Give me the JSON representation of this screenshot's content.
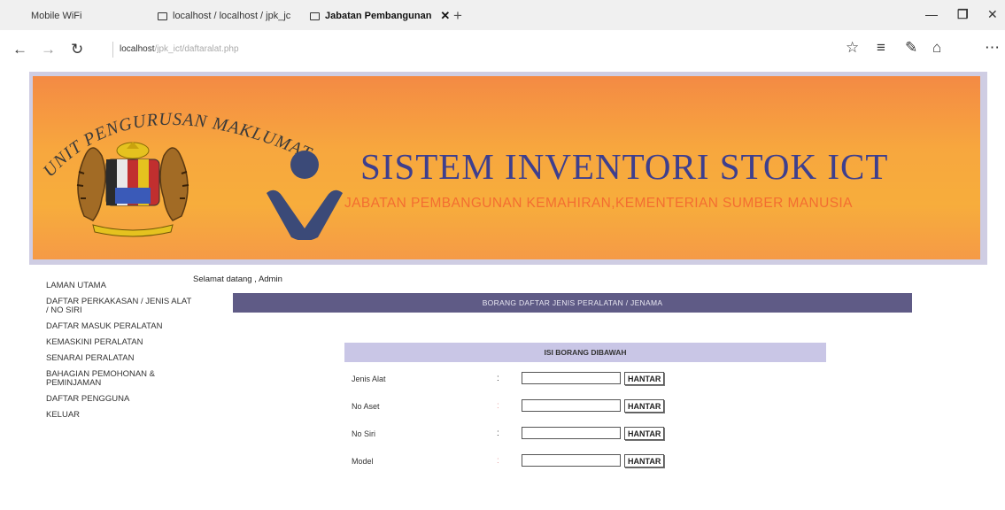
{
  "browser": {
    "tabs": [
      {
        "label": "Mobile WiFi"
      },
      {
        "label": "localhost / localhost / jpk_jc"
      },
      {
        "label": "Jabatan Pembangunan"
      }
    ],
    "address": {
      "host": "localhost",
      "path": "/jpk_ict/daftaralat.php"
    }
  },
  "banner": {
    "arc_text": "UNIT PENGURUSAN MAKLUMAT",
    "title": "SISTEM INVENTORI STOK ICT",
    "subtitle": "JABATAN PEMBANGUNAN KEMAHIRAN,KEMENTERIAN SUMBER MANUSIA"
  },
  "sidebar": {
    "items": [
      {
        "label": "LAMAN UTAMA"
      },
      {
        "label": "DAFTAR PERKAKASAN / JENIS ALAT / NO SIRI"
      },
      {
        "label": "DAFTAR MASUK PERALATAN"
      },
      {
        "label": "KEMASKINI PERALATAN"
      },
      {
        "label": "SENARAI PERALATAN"
      },
      {
        "label": "BAHAGIAN PEMOHONAN & PEMINJAMAN"
      },
      {
        "label": "DAFTAR PENGGUNA"
      },
      {
        "label": "KELUAR"
      }
    ]
  },
  "main": {
    "welcome": "Selamat datang , Admin",
    "form_title": "BORANG DAFTAR JENIS PERALATAN / JENAMA",
    "form_header": "ISI BORANG DIBAWAH",
    "rows": [
      {
        "label": "Jenis Alat",
        "colon": ":",
        "value": "",
        "button": "HANTAR"
      },
      {
        "label": "No Aset",
        "colon": ":",
        "value": "",
        "button": "HANTAR"
      },
      {
        "label": "No Siri",
        "colon": ":",
        "value": "",
        "button": "HANTAR"
      },
      {
        "label": "Model",
        "colon": ":",
        "value": "",
        "button": "HANTAR"
      }
    ]
  }
}
